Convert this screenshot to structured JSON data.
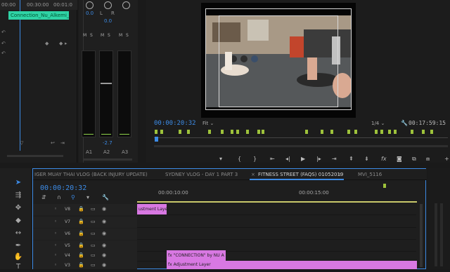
{
  "source": {
    "ruler_times": [
      "00:00",
      "00:30:00",
      "00:01:0"
    ],
    "clip_label": "Connection_Nu_Alkemi_I"
  },
  "mixer": {
    "pan_values": [
      "0.0",
      "0.0"
    ],
    "pan_labels": [
      "L",
      "R"
    ],
    "solo_labels": [
      "M",
      "S",
      "M",
      "S",
      "M",
      "S"
    ],
    "fader_readout": "-2.7",
    "channels": [
      "A1",
      "A2",
      "A3"
    ]
  },
  "program": {
    "timecode": "00:00:20:32",
    "fit": "Fit",
    "quality": "1/4",
    "duration": "00:17:59:15"
  },
  "transport": {
    "buttons": [
      "marker",
      "in",
      "out",
      "go-to-in",
      "step-back",
      "play",
      "step-forward",
      "go-to-out",
      "lift",
      "extract",
      "export-frame",
      "camera"
    ]
  },
  "timeline": {
    "tabs": [
      "IGER MUAY THAI VLOG (BACK INJURY UPDATE)",
      "SYDNEY VLOG - DAY 1 PART 3",
      "FITNESS STREET (FAQS) 01052019",
      "MVI_5116"
    ],
    "active_tab_menu": "≡",
    "timecode": "00:00:20:32",
    "ruler_labels": [
      "00:00:10:00",
      "00:00:15:00"
    ],
    "tracks": [
      "V8",
      "V7",
      "V6",
      "V5",
      "V4",
      "V3"
    ],
    "clips": {
      "v8_clip": "ustment Layer",
      "v4_clip": "\"CONNECTION\" by NU A",
      "v3_clip": "Adjustment Layer",
      "fx": "fx"
    }
  },
  "colors": {
    "accent": "#3c8be6",
    "clip_green": "#2fd3a5",
    "clip_pink": "#d878e2",
    "marker_green": "#9ec23b"
  }
}
